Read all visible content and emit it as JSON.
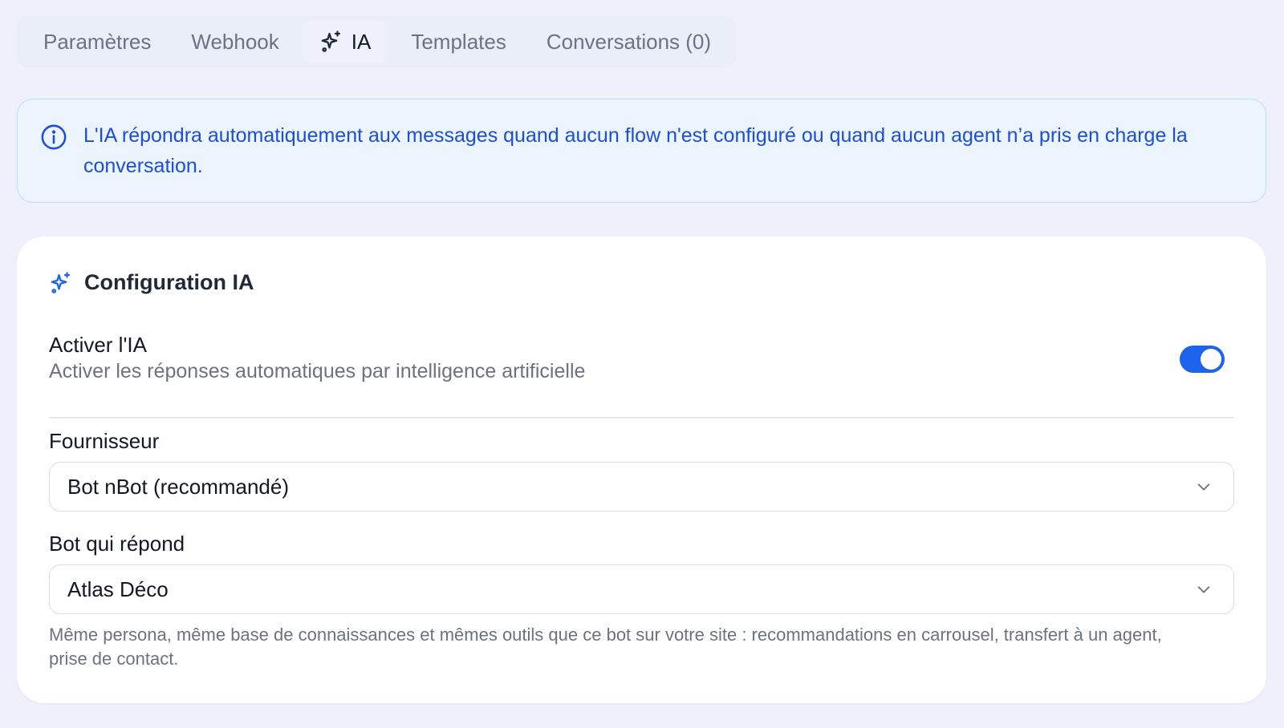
{
  "tabs": [
    {
      "label": "Paramètres",
      "active": false
    },
    {
      "label": "Webhook",
      "active": false
    },
    {
      "label": "IA",
      "active": true,
      "icon": "sparkles-icon"
    },
    {
      "label": "Templates",
      "active": false
    },
    {
      "label": "Conversations (0)",
      "active": false
    }
  ],
  "info_banner": {
    "icon": "info-icon",
    "text": "L'IA répondra automatiquement aux messages quand aucun flow n'est configuré ou quand aucun agent n’a pris en charge la conversation."
  },
  "config": {
    "title": "Configuration IA",
    "title_icon": "sparkles-icon",
    "ai_toggle": {
      "label": "Activer l'IA",
      "description": "Activer les réponses automatiques par intelligence artificielle",
      "enabled": true
    },
    "provider": {
      "label": "Fournisseur",
      "value": "Bot nBot (recommandé)"
    },
    "bot": {
      "label": "Bot qui répond",
      "value": "Atlas Déco"
    },
    "helper_text": "Même persona, même base de connaissances et mêmes outils que ce bot sur votre site : recommandations en carrousel, transfert à un agent, prise de contact."
  },
  "colors": {
    "accent": "#1d63ed",
    "info_text": "#1d4ed8",
    "info_bg": "#ecf4fd",
    "page_bg": "#eef1fb"
  }
}
